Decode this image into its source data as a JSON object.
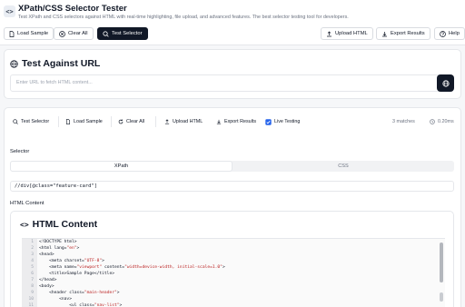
{
  "header": {
    "logo_glyph": "<>",
    "title": "XPath/CSS Selector Tester",
    "subtitle": "Test XPath and CSS selectors against HTML with real-time highlighting, file upload, and advanced features. The best selector testing tool for developers."
  },
  "toolbar": {
    "load_sample": "Load Sample",
    "clear_all": "Clear All",
    "test_selector": "Test Selector",
    "upload_html": "Upload HTML",
    "export_results": "Export Results",
    "help": "Help"
  },
  "url_section": {
    "title": "Test Against URL",
    "placeholder": "Enter URL to fetch HTML content..."
  },
  "tools": {
    "test_selector": "Test Selector",
    "load_sample": "Load Sample",
    "clear_all": "Clear All",
    "upload_html": "Upload HTML",
    "export_results": "Export Results",
    "live_testing": "Live Testing",
    "live_testing_checked": true,
    "matches": "3 matches",
    "time": "0.20ms"
  },
  "selector": {
    "label": "Selector",
    "tabs": [
      "XPath",
      "CSS"
    ],
    "active_tab": "XPath",
    "value": "//div[@class=\"feature-card\"]"
  },
  "html_content": {
    "label": "HTML Content",
    "title": "HTML Content",
    "lines": [
      {
        "n": "1",
        "parts": [
          [
            "tag",
            "<!DOCTYPE html>"
          ]
        ]
      },
      {
        "n": "2",
        "parts": [
          [
            "tag",
            "<html lang="
          ],
          [
            "str",
            "\"en\""
          ],
          [
            "tag",
            ">"
          ]
        ]
      },
      {
        "n": "3",
        "parts": [
          [
            "tag",
            "<head>"
          ]
        ]
      },
      {
        "n": "4",
        "parts": [
          [
            "tag",
            "    <meta charset="
          ],
          [
            "str",
            "\"UTF-8\""
          ],
          [
            "tag",
            ">"
          ]
        ]
      },
      {
        "n": "5",
        "parts": [
          [
            "tag",
            "    <meta name="
          ],
          [
            "str",
            "\"viewport\""
          ],
          [
            "tag",
            " content="
          ],
          [
            "str",
            "\"width=device-width, initial-scale=1.0\""
          ],
          [
            "tag",
            ">"
          ]
        ]
      },
      {
        "n": "6",
        "parts": [
          [
            "tag",
            "    <title>Sample Page</title>"
          ]
        ]
      },
      {
        "n": "7",
        "parts": [
          [
            "tag",
            "</head>"
          ]
        ]
      },
      {
        "n": "8",
        "parts": [
          [
            "tag",
            "<body>"
          ]
        ]
      },
      {
        "n": "9",
        "parts": [
          [
            "tag",
            "    <header class="
          ],
          [
            "str",
            "\"main-header\""
          ],
          [
            "tag",
            ">"
          ]
        ]
      },
      {
        "n": "10",
        "parts": [
          [
            "tag",
            "        <nav>"
          ]
        ]
      },
      {
        "n": "11",
        "parts": [
          [
            "tag",
            "            <ul class="
          ],
          [
            "str",
            "\"nav-list\""
          ],
          [
            "tag",
            ">"
          ]
        ]
      }
    ]
  }
}
